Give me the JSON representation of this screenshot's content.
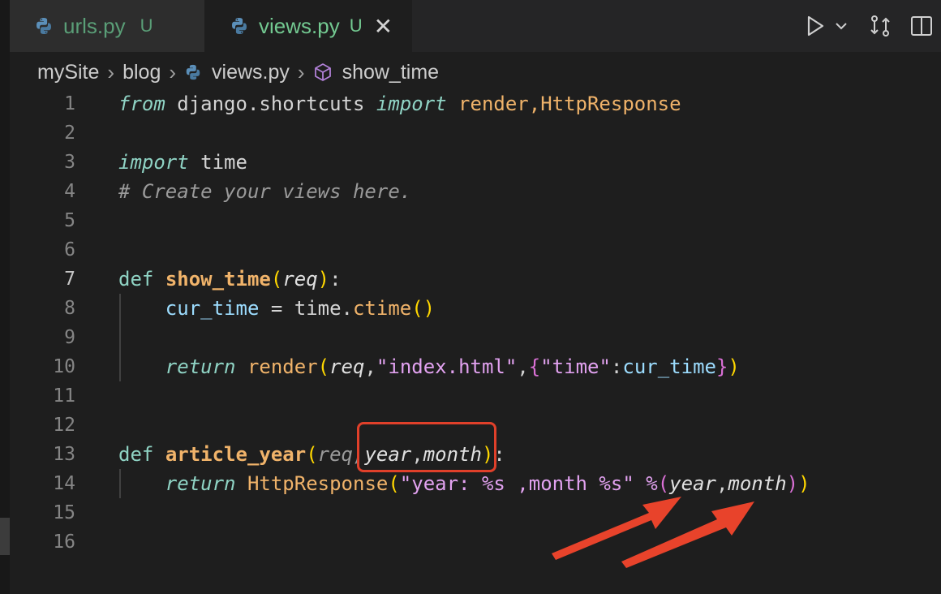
{
  "tabs": [
    {
      "name": "urls.py",
      "status": "U"
    },
    {
      "name": "views.py",
      "status": "U",
      "active": true
    }
  ],
  "breadcrumb": [
    "mySite",
    "blog",
    "views.py",
    "show_time"
  ],
  "line_numbers": [
    "1",
    "2",
    "3",
    "4",
    "5",
    "6",
    "7",
    "8",
    "9",
    "10",
    "11",
    "12",
    "13",
    "14",
    "15",
    "16"
  ],
  "active_line": "7",
  "code": {
    "l1": {
      "from": "from",
      "mod": " django.shortcuts ",
      "import": "import",
      "names": " render,HttpResponse"
    },
    "l3": {
      "import": "import",
      "mod": " time"
    },
    "l4": {
      "comment": "# Create your views here."
    },
    "l7": {
      "def": "def",
      "fn": "show_time",
      "open": "(",
      "param": "req",
      "close": ")",
      "colon": ":"
    },
    "l8": {
      "var": "cur_time",
      "eq": " = time.",
      "call": "ctime",
      "parens": "()"
    },
    "l10": {
      "ret": "return",
      "call": "render",
      "open": "(",
      "req": "req",
      "c1": ",",
      "s1": "\"index.html\"",
      "c2": ",",
      "bo": "{",
      "s2": "\"time\"",
      "colon": ":",
      "v": "cur_time",
      "bc": "}",
      "close": ")"
    },
    "l13": {
      "def": "def",
      "fn": "article_year",
      "open": "(",
      "req": "req,",
      "p1": "year",
      "comma": ",",
      "p2": "month",
      "close": ")",
      "colon": ":"
    },
    "l14": {
      "ret": "return",
      "call": "HttpResponse",
      "open": "(",
      "s": "\"year: %s ,month %s\"",
      "op": " %",
      "open2": "(",
      "a": "year",
      "comma": ",",
      "b": "month",
      "close2": ")",
      "close": ")"
    }
  },
  "colors": {
    "highlight": "#e0402a",
    "arrow": "#e8432b"
  }
}
